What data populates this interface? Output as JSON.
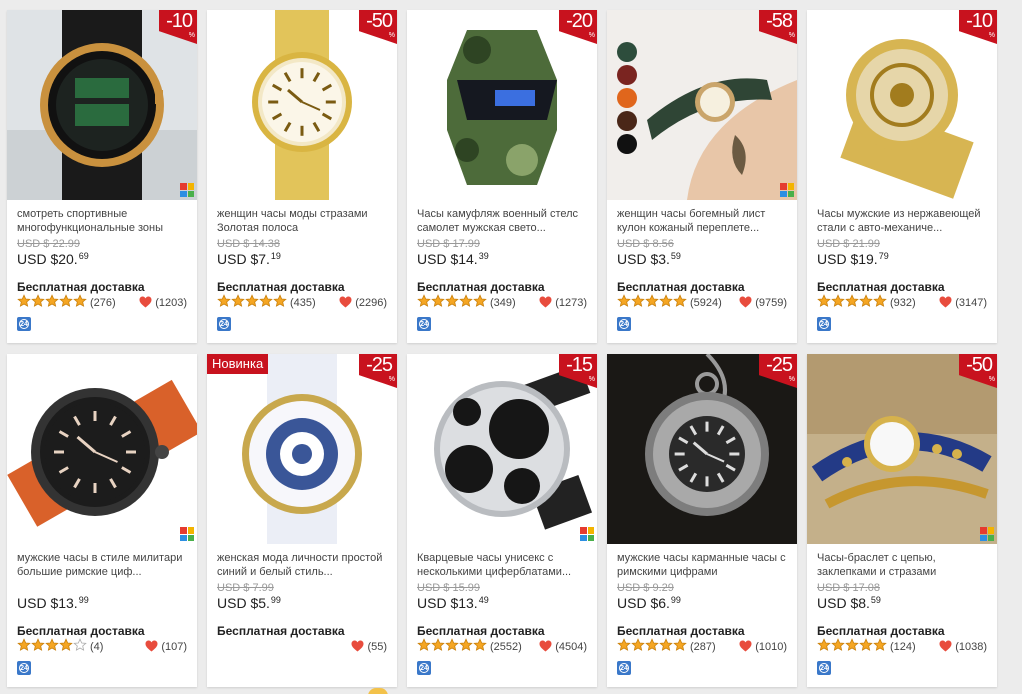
{
  "shipping_label": "Бесплатная доставка",
  "badge_new": "Новинка",
  "products": [
    {
      "title": "смотреть спортивные многофункциональные зоны",
      "old_price": "USD $ 22.99",
      "price_main": "USD $20.",
      "price_cents": "69",
      "discount": "-10",
      "rating_count": "(276)",
      "favorites": "(1203)",
      "stars": 5
    },
    {
      "title": "женщин часы моды стразами Золотая полоса",
      "old_price": "USD $ 14.38",
      "price_main": "USD $7.",
      "price_cents": "19",
      "discount": "-50",
      "rating_count": "(435)",
      "favorites": "(2296)",
      "stars": 5
    },
    {
      "title": "Часы камуфляж военный стелс самолет мужская свето...",
      "old_price": "USD $ 17.99",
      "price_main": "USD $14.",
      "price_cents": "39",
      "discount": "-20",
      "rating_count": "(349)",
      "favorites": "(1273)",
      "stars": 5
    },
    {
      "title": "женщин часы богемный лист кулон кожаный переплете...",
      "old_price": "USD $ 8.56",
      "price_main": "USD $3.",
      "price_cents": "59",
      "discount": "-58",
      "rating_count": "(5924)",
      "favorites": "(9759)",
      "stars": 5,
      "color_options": [
        "#2d4d3c",
        "#7a2420",
        "#e0661c",
        "#4a2718",
        "#111111"
      ]
    },
    {
      "title": "Часы мужские из нержавеющей стали с авто-механиче...",
      "old_price": "USD $ 21.99",
      "price_main": "USD $19.",
      "price_cents": "79",
      "discount": "-10",
      "rating_count": "(932)",
      "favorites": "(3147)",
      "stars": 5
    },
    {
      "title": "мужские часы в стиле милитари большие римские циф...",
      "old_price": "",
      "price_main": "USD $13.",
      "price_cents": "99",
      "discount": "",
      "rating_count": "(4)",
      "favorites": "(107)",
      "stars": 4
    },
    {
      "title": "женская мода личности простой синий и белый стиль...",
      "old_price": "USD $ 7.99",
      "price_main": "USD $5.",
      "price_cents": "99",
      "discount": "-25",
      "rating_count": "",
      "favorites": "(55)",
      "stars": 0,
      "is_new": true
    },
    {
      "title": "Кварцевые часы унисекс с несколькими циферблатами...",
      "old_price": "USD $ 15.99",
      "price_main": "USD $13.",
      "price_cents": "49",
      "discount": "-15",
      "rating_count": "(2552)",
      "favorites": "(4504)",
      "stars": 5
    },
    {
      "title": "мужские часы карманные часы с римскими цифрами",
      "old_price": "USD $ 9.29",
      "price_main": "USD $6.",
      "price_cents": "99",
      "discount": "-25",
      "rating_count": "(287)",
      "favorites": "(1010)",
      "stars": 5
    },
    {
      "title": "Часы-браслет с цепью, заклепками и стразами",
      "old_price": "USD $ 17.08",
      "price_main": "USD $8.",
      "price_cents": "59",
      "discount": "-50",
      "rating_count": "(124)",
      "favorites": "(1038)",
      "stars": 5
    }
  ],
  "colors": {
    "discount_red": "#c8121e",
    "heart": "#e84c3d",
    "star": "#f5a623",
    "badge_24h": "#3a78c9"
  },
  "icons": [
    "star-icon",
    "heart-icon",
    "24h-delivery-icon",
    "multicolor-icon"
  ]
}
